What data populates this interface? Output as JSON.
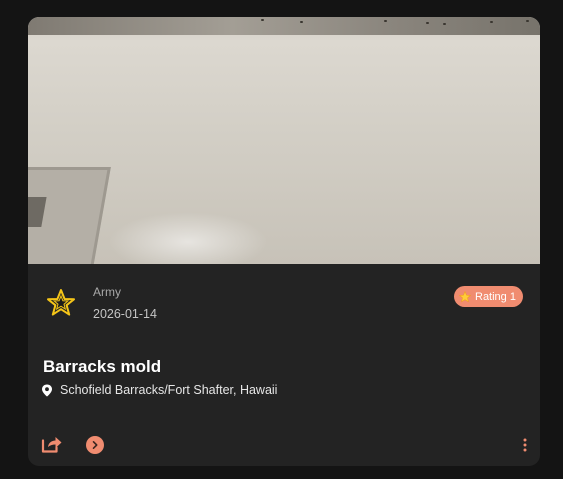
{
  "card": {
    "photo_description": "",
    "branch": "Army",
    "date": "2026-01-14",
    "rating_label": "Rating 1",
    "title": "Barracks mold",
    "location": "Schofield Barracks/Fort Shafter, Hawaii"
  },
  "icons": {
    "branch": "army-star-icon",
    "rating": "star-icon",
    "location": "map-pin-icon",
    "share": "share-icon",
    "open": "chevron-right-icon",
    "more": "more-vertical-icon"
  },
  "colors": {
    "accent": "#f08c70",
    "star_gold": "#f5c518",
    "card_bg": "#232323",
    "page_bg": "#141414"
  }
}
